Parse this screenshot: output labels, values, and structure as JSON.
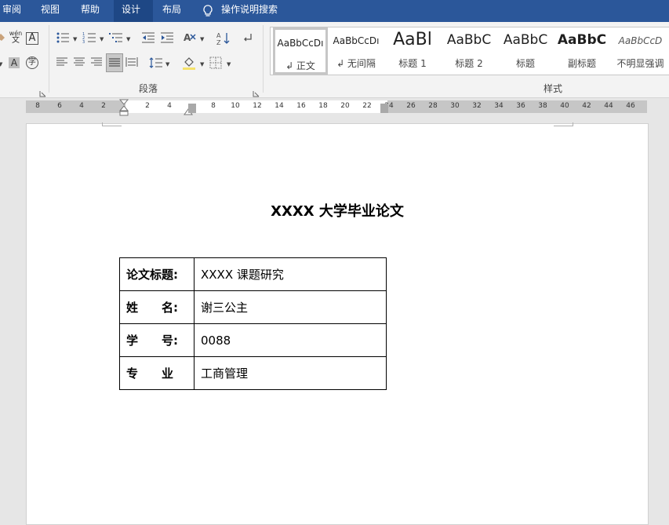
{
  "tabs": [
    {
      "label": "审阅",
      "active": false
    },
    {
      "label": "视图",
      "active": false
    },
    {
      "label": "帮助",
      "active": false
    },
    {
      "label": "设计",
      "active": true
    },
    {
      "label": "布局",
      "active": false
    }
  ],
  "tell_me": {
    "label": "操作说明搜索"
  },
  "ribbon": {
    "font_group": {
      "phonetic_glyph": "wén",
      "phonetic_char": "文",
      "border_char": "A",
      "shade_char": "A",
      "enclose_char": "字"
    },
    "paragraph_group": {
      "label": "段落"
    },
    "styles_group": {
      "label": "样式"
    },
    "styles": [
      {
        "sample": "AaBbCcDı",
        "name": "↲ 正文",
        "active": true
      },
      {
        "sample": "AaBbCcDı",
        "name": "↲ 无间隔",
        "active": false
      },
      {
        "sample": "AaBl",
        "name": "标题 1",
        "active": false
      },
      {
        "sample": "AaBbC",
        "name": "标题 2",
        "active": false
      },
      {
        "sample": "AaBbC",
        "name": "标题",
        "active": false
      },
      {
        "sample": "AaBbC",
        "name": "副标题",
        "active": false
      },
      {
        "sample": "AaBbCcD",
        "name": "不明显强调",
        "active": false
      }
    ]
  },
  "ruler": {
    "ticks": [
      "8",
      "6",
      "4",
      "2",
      "2",
      "4",
      "8",
      "10",
      "12",
      "14",
      "16",
      "18",
      "20",
      "22",
      "24",
      "26",
      "28",
      "30",
      "32",
      "34",
      "36",
      "38",
      "40",
      "42",
      "44",
      "46"
    ]
  },
  "document": {
    "title": "XXXX 大学毕业论文",
    "rows": [
      {
        "label": "论文标题:",
        "value": "XXXX 课题研究"
      },
      {
        "label": "姓　　名:",
        "value": "谢三公主"
      },
      {
        "label": "学　　号:",
        "value": "0088"
      },
      {
        "label": "专　　业",
        "value": "工商管理"
      }
    ]
  },
  "colors": {
    "ribbon_blue": "#2b579a",
    "ribbon_blue_active": "#1e4785",
    "ribbon_bg": "#f3f3f3"
  }
}
